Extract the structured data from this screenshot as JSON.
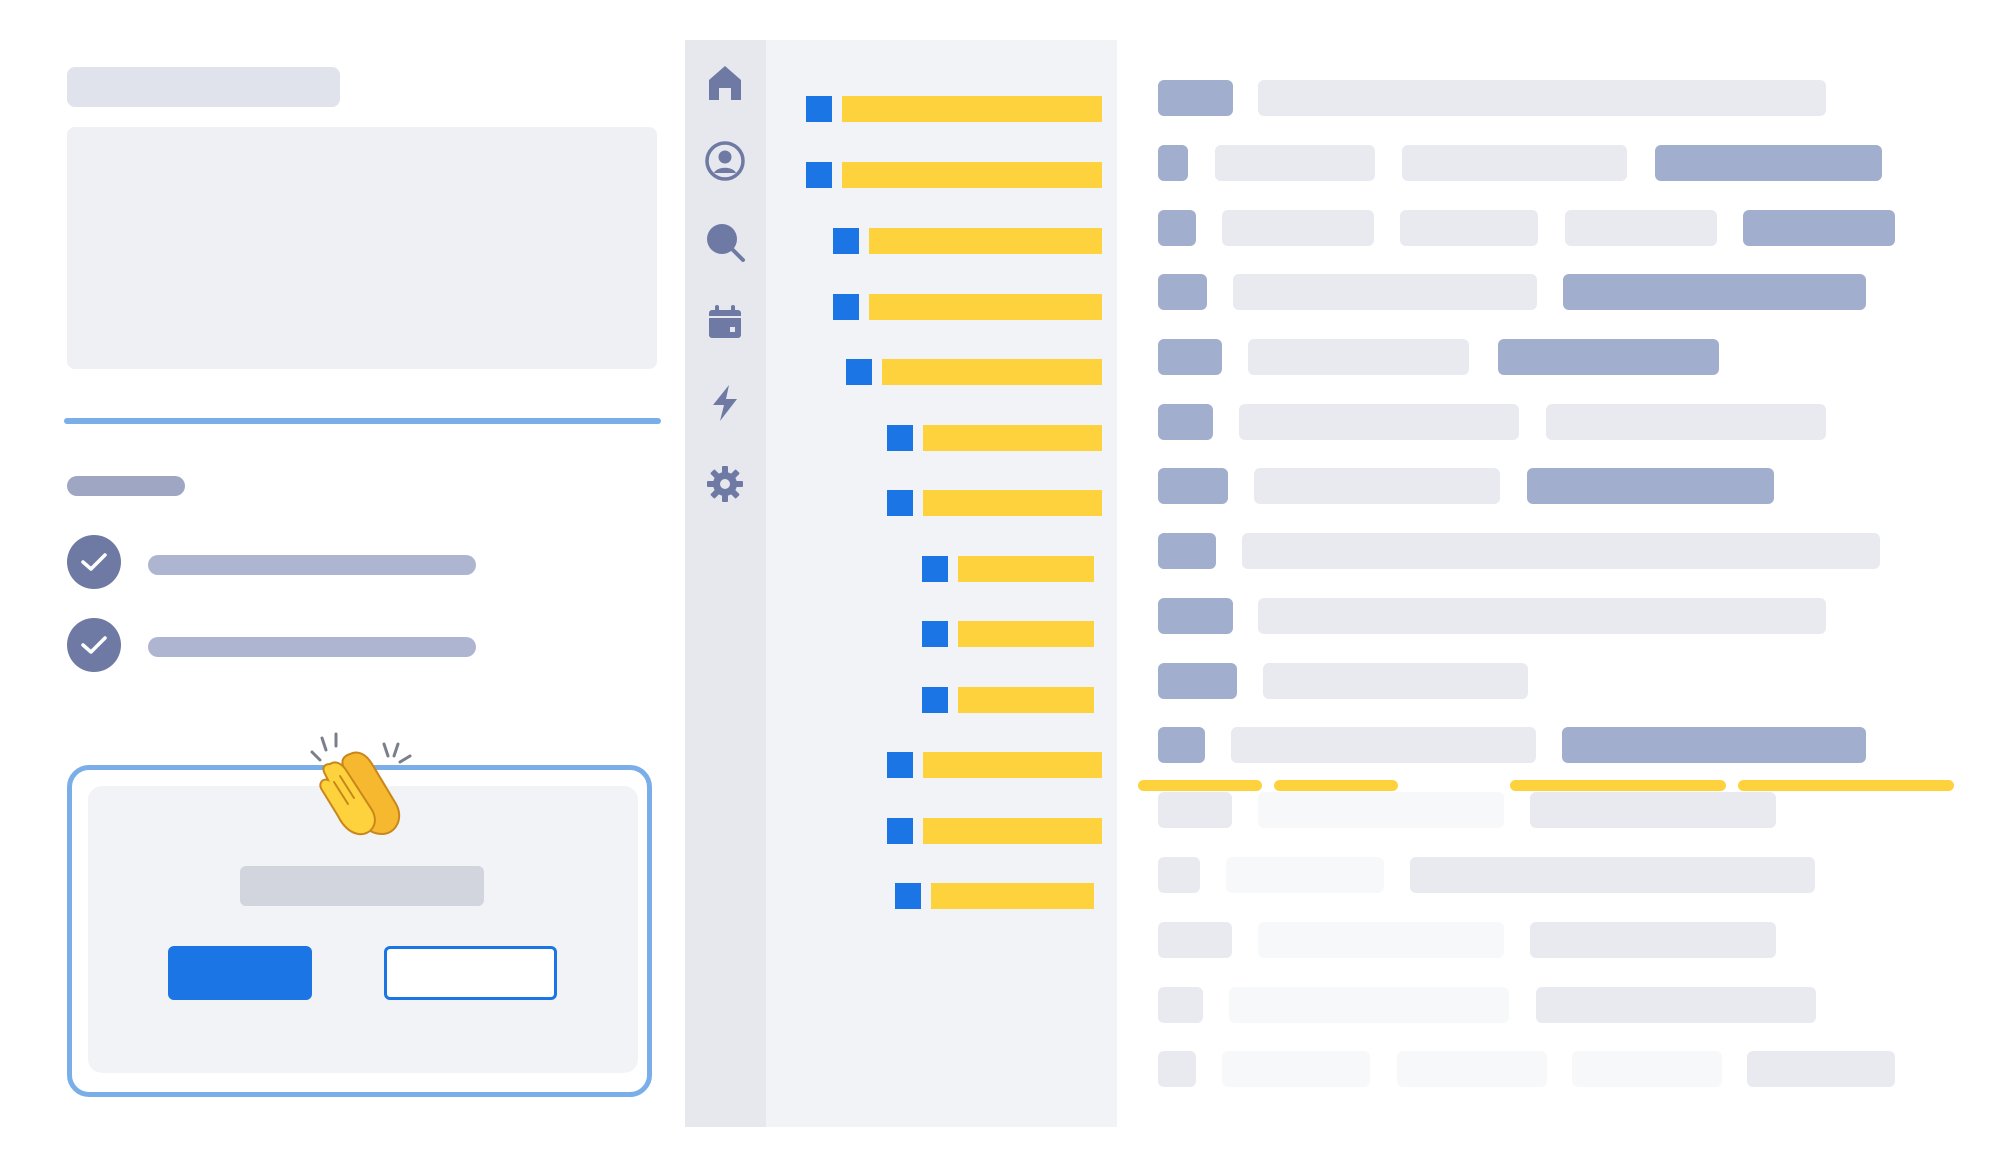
{
  "colors": {
    "accent_blue": "#1b75e4",
    "outline_blue": "#7aaee9",
    "highlight_yellow": "#fdd23c",
    "placeholder_dark": "#a2aecd",
    "placeholder_light": "#e8eaf0",
    "check_circle": "#6e7aa3",
    "rail_background": "#e6e8ee"
  },
  "sidebar": {
    "icons": [
      "home-icon",
      "user-circle-icon",
      "search-icon",
      "calendar-icon",
      "lightning-icon",
      "gear-icon"
    ]
  },
  "checklist": {
    "items": [
      {
        "checked": true
      },
      {
        "checked": true
      }
    ]
  },
  "modal": {
    "decoration": "clapping-hands-emoji",
    "emoji": "👏"
  },
  "tree": {
    "node_count": 13,
    "depths": [
      0,
      0,
      1,
      1,
      2,
      3,
      3,
      4,
      4,
      4,
      3,
      3,
      3
    ]
  },
  "table": {
    "row_count": 16
  }
}
